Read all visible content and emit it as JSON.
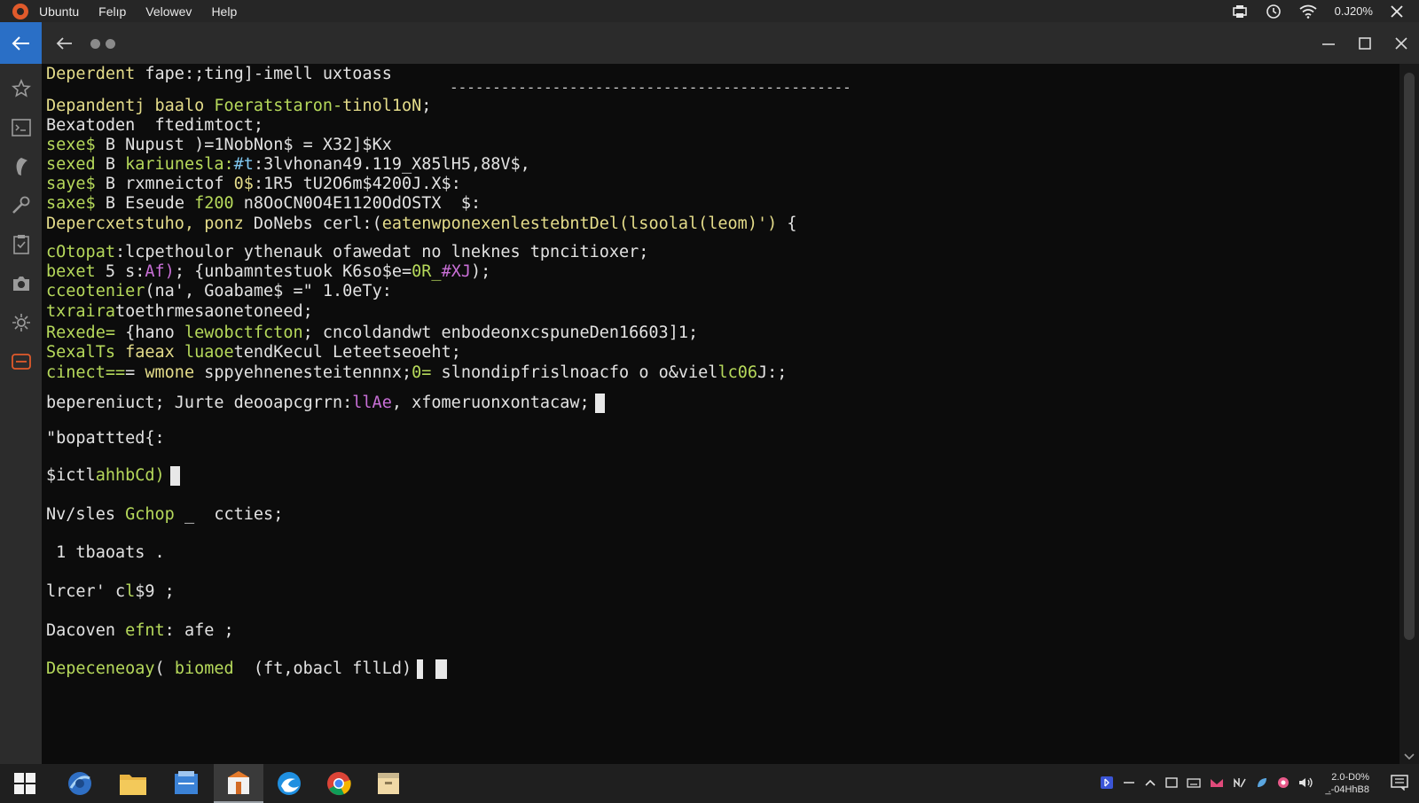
{
  "topbar": {
    "logo_icon": "ubuntu-logo-icon",
    "menus": [
      "Ubuntu",
      "Felıp",
      "Velowev",
      "Help"
    ],
    "status": "0.J20%"
  },
  "titlebar": {
    "accent": "#2a6fc6"
  },
  "sidebar": {
    "icons": [
      "star-icon",
      "terminal-panel-icon",
      "tag-icon",
      "wrench-icon",
      "clipboard-icon",
      "camera-icon",
      "settings-icon",
      "inbox-icon"
    ],
    "active_accent": "#e05a2b"
  },
  "terminal": {
    "header_a": "Deperdent",
    "header_b": "fape:;ting]-imell",
    "header_c": "uxtoass",
    "dashes": "-----------------------------------------------",
    "l2a": "Depandentj",
    "l2b": "baalo",
    "l2c": "Foeratstaron-",
    "l2d": "tinol1oN",
    "l2e": ";",
    "l3": "Bexatoden  ftedimtoct;",
    "l4a": "sexe$",
    "l4b": "B Nupust )=1NobNon$ = X32]$K",
    "l4c": "x",
    "l5a": "sexed",
    "l5b": "B",
    "l5c": "kariunesla:",
    "l5d": "#t",
    "l5e": ":3lvhonan49.119_X85lH5,88V$,",
    "l6a": "saye$",
    "l6b": "B",
    "l6c": "rxmneictof",
    "l6d": "0$",
    "l6e": ":1R5 tU2O6m$4200J.X$:",
    "l7a": "saxe$",
    "l7b": "B",
    "l7c": "Eseude",
    "l7d": "f200",
    "l7e": "n8OoCN0O4E1120OdOSTX  $:",
    "l8a": "Depercxetstuho, ",
    "l8b": "ponz",
    "l8c": " DoNebs cerl:(",
    "l8d": "eatenwponexenlestebntDel(lsoolal(leom)')",
    "l8e": " {",
    "l9a": "cOtopat",
    "l9b": ":lcpethoulor ythenauk ofawedat no lneknes tpncitioxer;",
    "l10a": "bexet",
    "l10b": " 5 s:",
    "l10c": "Af)",
    "l10d": "; {unbamntestuok K6so$e=",
    "l10e": "0R_",
    "l10f": "#XJ",
    "l10g": ");",
    "l11a": "cceotenier",
    "l11b": "(na', Goabame$ =\" 1.0eTy:",
    "l12a": "txraira",
    "l12b": "toethrmesaonetoneed;",
    "l13a": "Rexede=",
    "l13b": " {hano ",
    "l13c": "lewobctfcton",
    "l13d": "; cncoldandwt enbodeonxcspuneDen16603]1;",
    "l14a": "SexalTs",
    "l14b": "faeax",
    "l14c": "luaoe",
    "l14d": "tendKecul",
    "l14e": "Leteetseoeht;",
    "l15a": "cinect==",
    "l15b": "= ",
    "l15c": "wmone",
    "l15d": " sppyehnenesteitennnx;",
    "l15e": "0=",
    "l15f": " slnondipfrislnoacfo o o",
    "l15g": "&viel",
    "l15h": "lc06",
    "l15i": "J:;",
    "l16a": "bepereniuct; Jurte deooa",
    "l16b": "pcgrrn:",
    "l16c": "llAe",
    "l16d": ", xfomeruonxontacaw;",
    "l17": "\"bopattted{:",
    "l18a": "$ictl",
    "l18b": "ahhbCd)",
    "l19a": "Nv/sles ",
    "l19b": "Gchop",
    "l19c": " _  ccties;",
    "l20": " 1 tbaoats .",
    "l21a": "lrcer' c",
    "l21b": "l",
    "l21c": "$9 ;",
    "l22a": "Dacoven ",
    "l22b": "efnt",
    "l22c": ": afe ;",
    "l23a": "Depeceneoay",
    "l23b": "( ",
    "l23c": "biomed",
    "l23d": "  (ft,obacl fllLd)"
  },
  "taskbar": {
    "apps": [
      "windows-start-icon",
      "browser-icon",
      "file-explorer-icon",
      "documents-icon",
      "package-icon",
      "edge-icon",
      "chrome-icon",
      "archive-icon"
    ],
    "clock_line1": "2.0-D0%",
    "clock_line2": "̲.-04HhB8"
  }
}
